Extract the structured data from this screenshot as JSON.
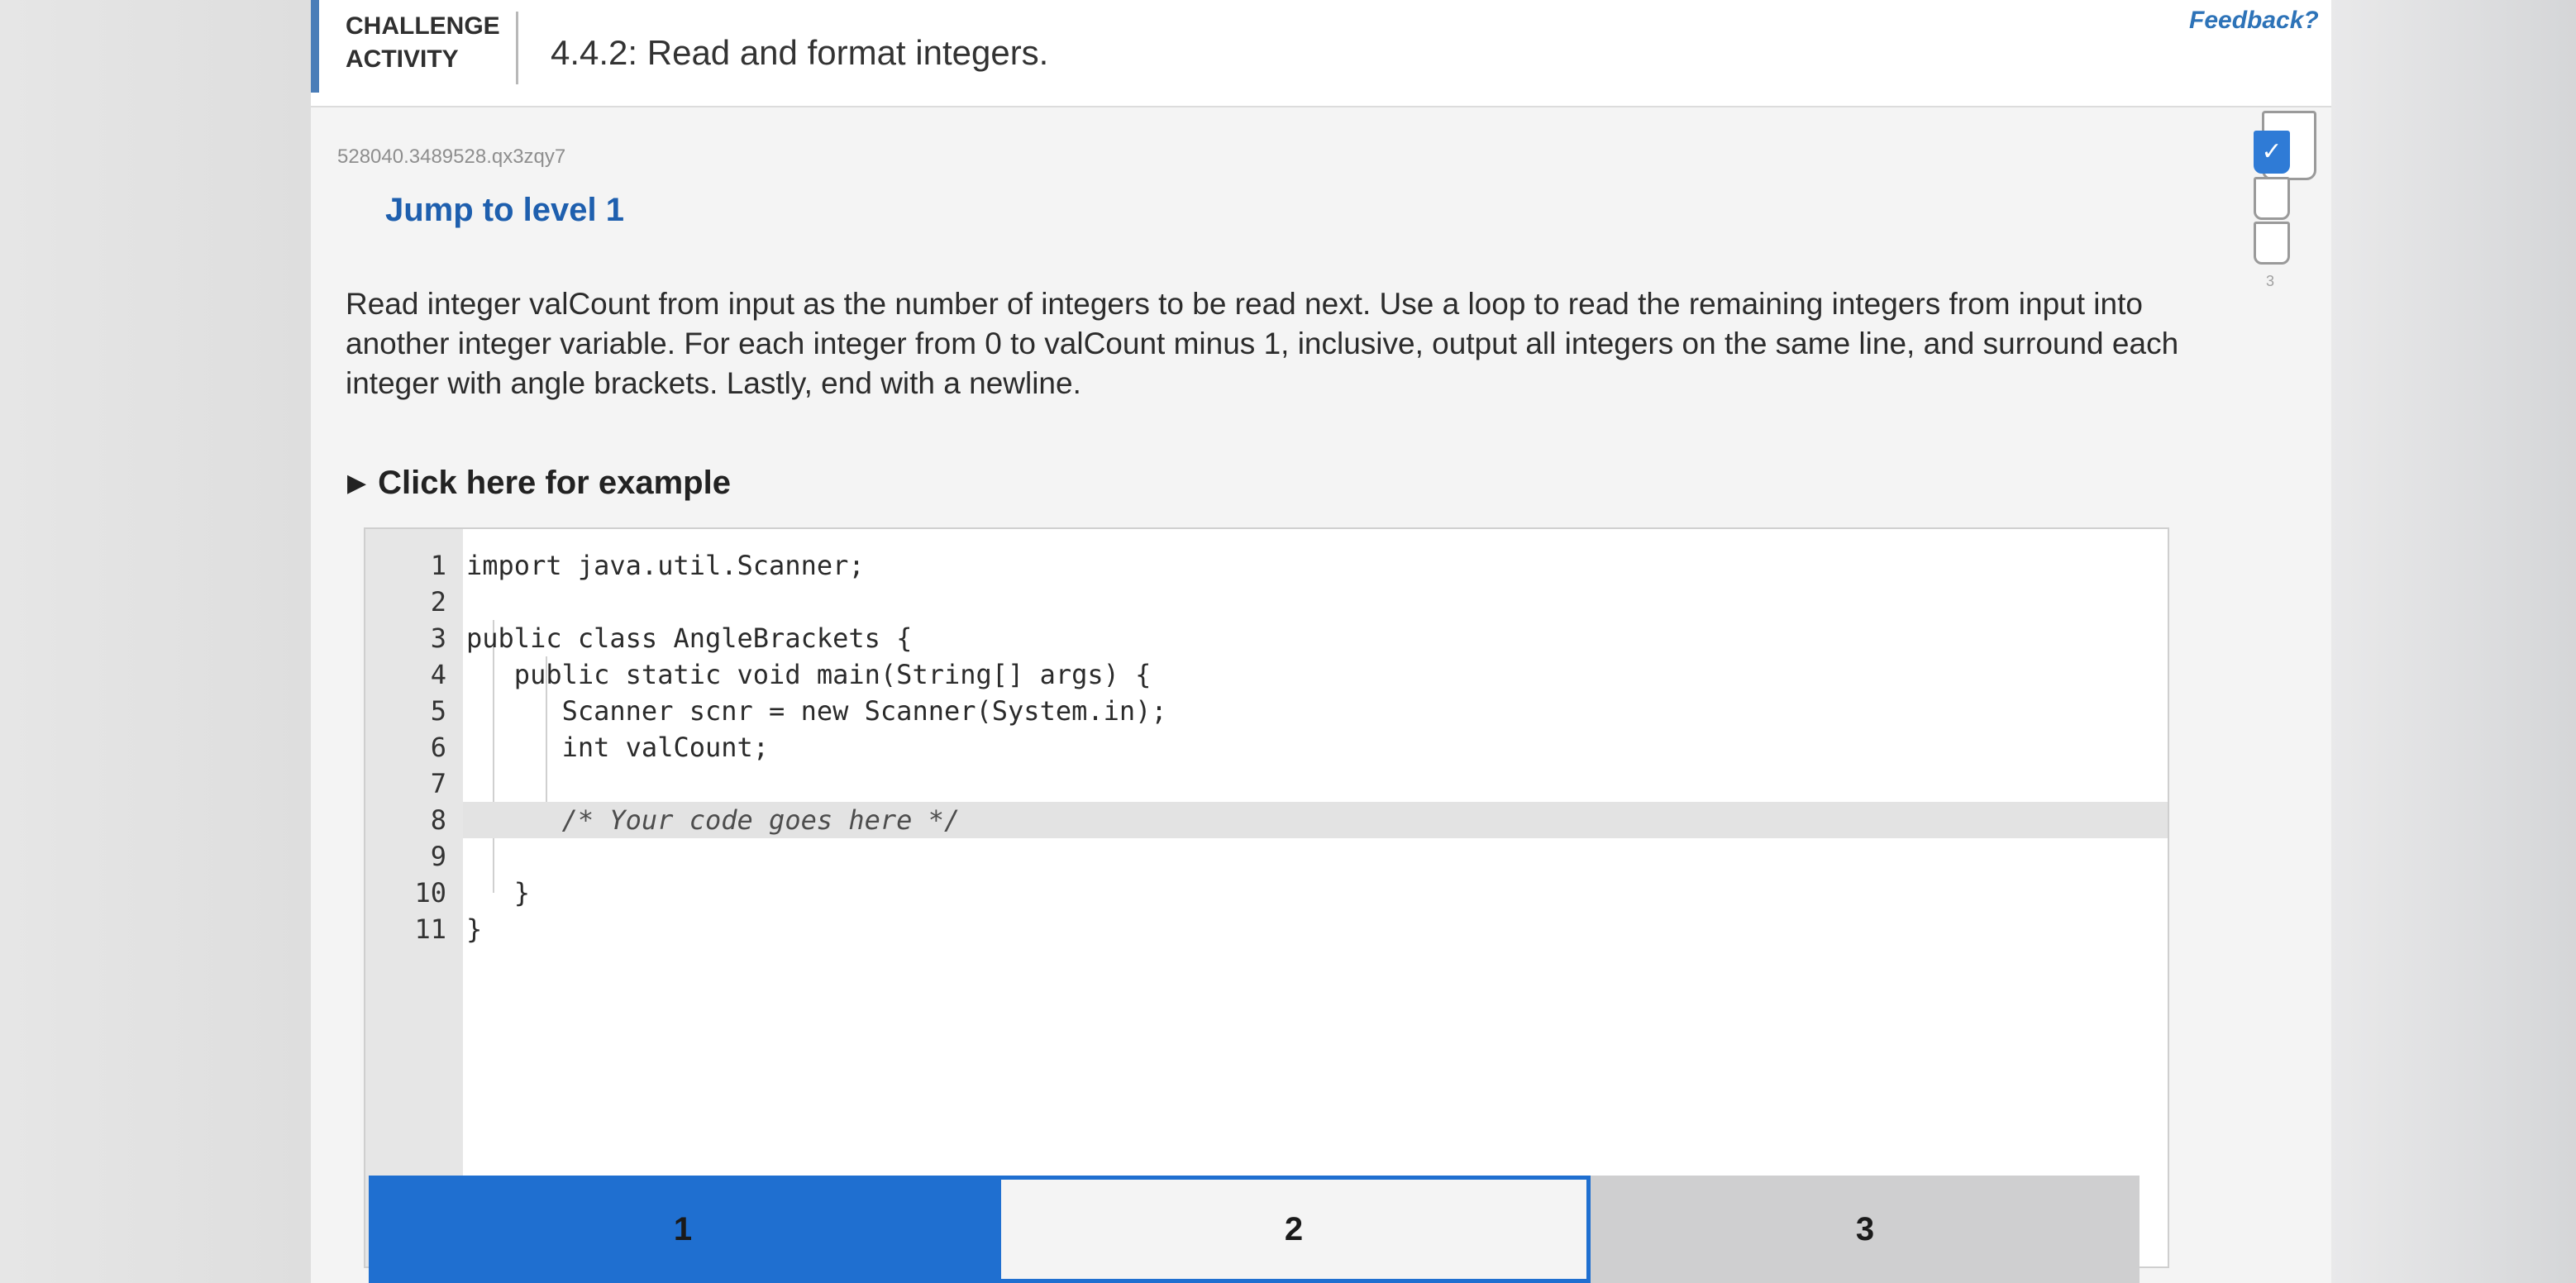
{
  "header": {
    "challenge_line1": "CHALLENGE",
    "challenge_line2": "ACTIVITY",
    "title": "4.4.2: Read and format integers.",
    "feedback": "Feedback?"
  },
  "activity": {
    "id": "528040.3489528.qx3zqy7",
    "jump_label": "Jump to level 1",
    "instructions": "Read integer valCount from input as the number of integers to be read next. Use a loop to read the remaining integers from input into another integer variable. For each integer from 0 to valCount minus 1, inclusive, output all integers on the same line, and surround each integer with angle brackets. Lastly, end with a newline.",
    "example_toggle": "Click here for example"
  },
  "code": {
    "line_numbers": [
      "1",
      "2",
      "3",
      "4",
      "5",
      "6",
      "7",
      "8",
      "9",
      "10",
      "11"
    ],
    "lines": [
      "import java.util.Scanner;",
      "",
      "public class AngleBrackets {",
      "   public static void main(String[] args) {",
      "      Scanner scnr = new Scanner(System.in);",
      "      int valCount;",
      "",
      "      /* Your code goes here */",
      "",
      "   }",
      "}"
    ],
    "active_line": 8
  },
  "progress": {
    "level_numbers": [
      "1",
      "2",
      "3"
    ],
    "completed": [
      true,
      false,
      false
    ],
    "check_glyph": "✓"
  },
  "levels": {
    "l1": "1",
    "l2": "2",
    "l3": "3"
  },
  "colors": {
    "accent": "#1f6fd0",
    "link": "#1e5fae",
    "header_accent": "#4a7db8"
  }
}
